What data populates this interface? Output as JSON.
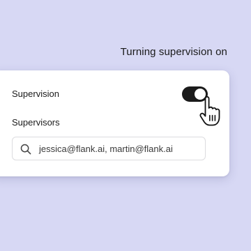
{
  "caption": "Turning supervision on",
  "settings": {
    "supervision_label": "Supervision",
    "supervision_enabled": true,
    "supervisors_label": "Supervisors",
    "supervisors_value": "jessica@flank.ai, martin@flank.ai"
  },
  "icons": {
    "search": "search-icon",
    "cursor": "hand-pointer-icon"
  },
  "colors": {
    "background": "#d7d8f4",
    "toggle_on": "#1b1b1b"
  }
}
